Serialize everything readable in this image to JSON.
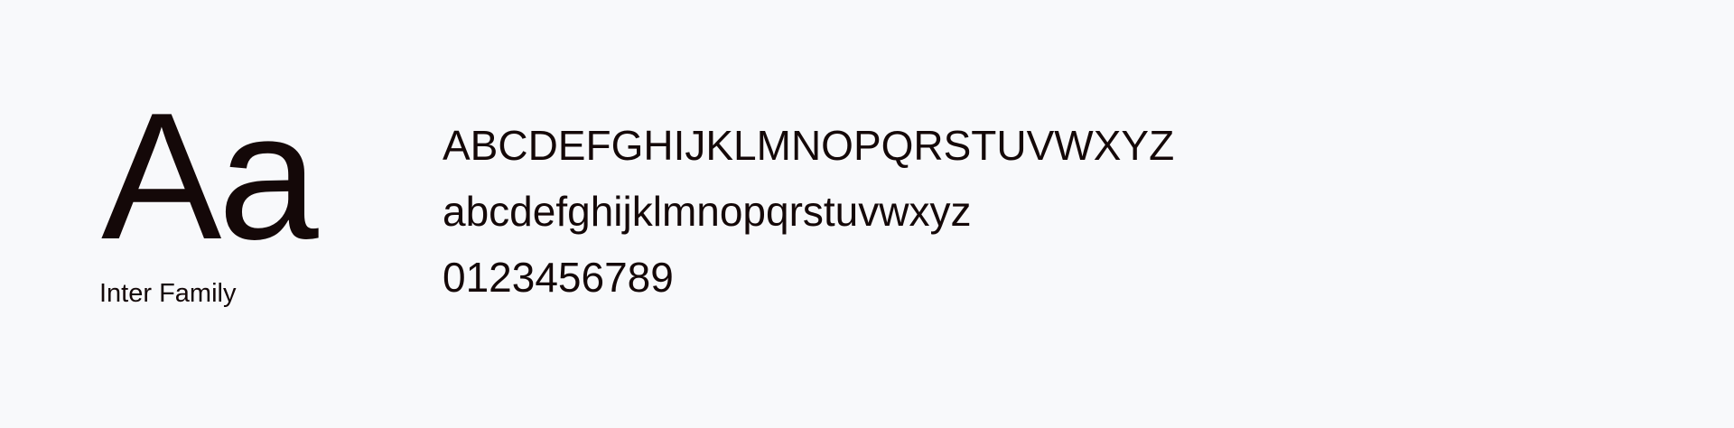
{
  "specimen": {
    "sample_glyphs": "Aa",
    "family_name": "Inter Family",
    "charset": {
      "uppercase": "ABCDEFGHIJKLMNOPQRSTUVWXYZ",
      "lowercase": "abcdefghijklmnopqrstuvwxyz",
      "digits": "0123456789"
    }
  },
  "colors": {
    "background": "#f8f9fb",
    "text": "#140808"
  }
}
